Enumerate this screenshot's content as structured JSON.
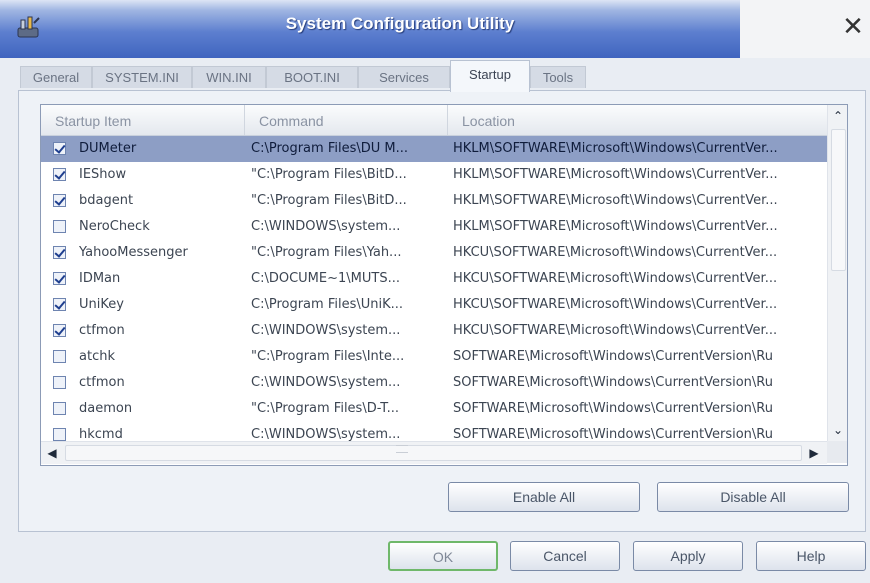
{
  "window": {
    "title": "System Configuration Utility",
    "close_glyph": "✕",
    "icon": "msconfig-app-icon"
  },
  "tabs": [
    {
      "label": "General",
      "active": false
    },
    {
      "label": "SYSTEM.INI",
      "active": false
    },
    {
      "label": "WIN.INI",
      "active": false
    },
    {
      "label": "BOOT.INI",
      "active": false
    },
    {
      "label": "Services",
      "active": false
    },
    {
      "label": "Startup",
      "active": true
    },
    {
      "label": "Tools",
      "active": false
    }
  ],
  "startup_list": {
    "columns": [
      "Startup Item",
      "Command",
      "Location"
    ],
    "rows": [
      {
        "checked": true,
        "selected": true,
        "item": "DUMeter",
        "command": "C:\\Program Files\\DU M...",
        "location": "HKLM\\SOFTWARE\\Microsoft\\Windows\\CurrentVer..."
      },
      {
        "checked": true,
        "selected": false,
        "item": "IEShow",
        "command": "\"C:\\Program Files\\BitD...",
        "location": "HKLM\\SOFTWARE\\Microsoft\\Windows\\CurrentVer..."
      },
      {
        "checked": true,
        "selected": false,
        "item": "bdagent",
        "command": "\"C:\\Program Files\\BitD...",
        "location": "HKLM\\SOFTWARE\\Microsoft\\Windows\\CurrentVer..."
      },
      {
        "checked": false,
        "selected": false,
        "item": "NeroCheck",
        "command": "C:\\WINDOWS\\system...",
        "location": "HKLM\\SOFTWARE\\Microsoft\\Windows\\CurrentVer..."
      },
      {
        "checked": true,
        "selected": false,
        "item": "YahooMessenger",
        "command": "\"C:\\Program Files\\Yah...",
        "location": "HKCU\\SOFTWARE\\Microsoft\\Windows\\CurrentVer..."
      },
      {
        "checked": true,
        "selected": false,
        "item": "IDMan",
        "command": "C:\\DOCUME~1\\MUTS...",
        "location": "HKCU\\SOFTWARE\\Microsoft\\Windows\\CurrentVer..."
      },
      {
        "checked": true,
        "selected": false,
        "item": "UniKey",
        "command": "C:\\Program Files\\UniK...",
        "location": "HKCU\\SOFTWARE\\Microsoft\\Windows\\CurrentVer..."
      },
      {
        "checked": true,
        "selected": false,
        "item": "ctfmon",
        "command": "C:\\WINDOWS\\system...",
        "location": "HKCU\\SOFTWARE\\Microsoft\\Windows\\CurrentVer..."
      },
      {
        "checked": false,
        "selected": false,
        "item": "atchk",
        "command": "\"C:\\Program Files\\Inte...",
        "location": "SOFTWARE\\Microsoft\\Windows\\CurrentVersion\\Ru"
      },
      {
        "checked": false,
        "selected": false,
        "item": "ctfmon",
        "command": "C:\\WINDOWS\\system...",
        "location": "SOFTWARE\\Microsoft\\Windows\\CurrentVersion\\Ru"
      },
      {
        "checked": false,
        "selected": false,
        "item": "daemon",
        "command": "\"C:\\Program Files\\D-T...",
        "location": "SOFTWARE\\Microsoft\\Windows\\CurrentVersion\\Ru"
      },
      {
        "checked": false,
        "selected": false,
        "item": "hkcmd",
        "command": "C:\\WINDOWS\\system...",
        "location": "SOFTWARE\\Microsoft\\Windows\\CurrentVersion\\Ru"
      }
    ]
  },
  "scrollbar": {
    "up_glyph": "⌃",
    "down_glyph": "⌄",
    "left_glyph": "◀",
    "right_glyph": "▶"
  },
  "list_actions": {
    "enable_all": "Enable All",
    "disable_all": "Disable All"
  },
  "dialog_buttons": {
    "ok": "OK",
    "cancel": "Cancel",
    "apply": "Apply",
    "help": "Help"
  },
  "colors": {
    "selection": "#8d9ec5",
    "titlebar": "#3f64bf",
    "ok_border": "#6fb86a"
  }
}
